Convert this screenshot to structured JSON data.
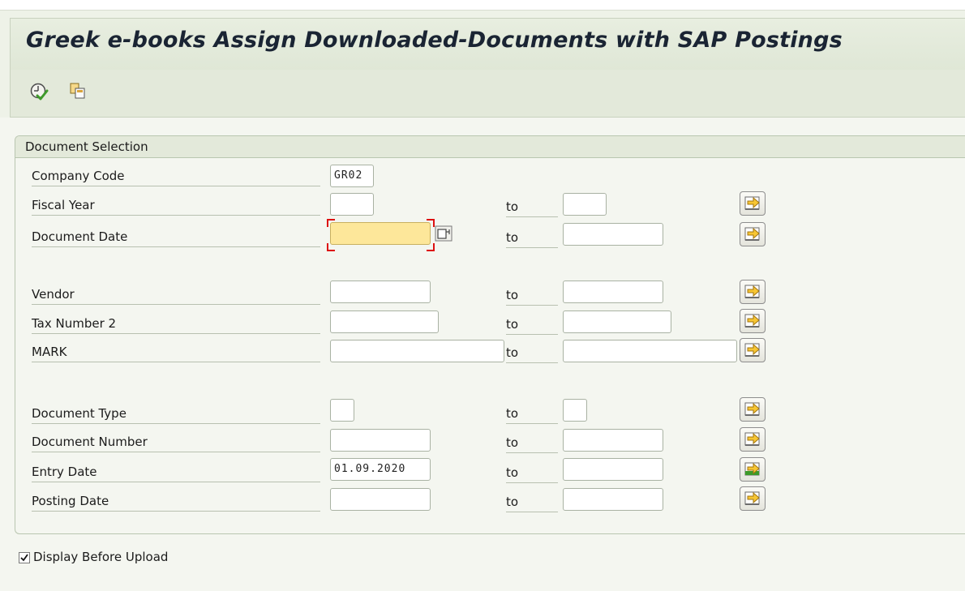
{
  "header": {
    "title": "Greek e-books Assign Downloaded-Documents with SAP Postings"
  },
  "toolbar": {
    "icons": [
      "execute-icon",
      "copy-icon"
    ]
  },
  "selection": {
    "group_title": "Document Selection",
    "to_label": "to",
    "rows": [
      {
        "label": "Company Code",
        "from": "GR02"
      },
      {
        "label": "Fiscal Year",
        "from": "",
        "to": ""
      },
      {
        "label": "Document Date",
        "from": "",
        "to": ""
      },
      {
        "label": "Vendor",
        "from": "",
        "to": ""
      },
      {
        "label": "Tax Number 2",
        "from": "",
        "to": ""
      },
      {
        "label": "MARK",
        "from": "",
        "to": ""
      },
      {
        "label": "Document Type",
        "from": "",
        "to": ""
      },
      {
        "label": "Document Number",
        "from": "",
        "to": ""
      },
      {
        "label": "Entry Date",
        "from": "01.09.2020",
        "to": ""
      },
      {
        "label": "Posting Date",
        "from": "",
        "to": ""
      }
    ]
  },
  "options": {
    "display_before_upload": {
      "label": "Display Before Upload",
      "checked": true
    }
  },
  "colors": {
    "title_bg": "#dfe7d6",
    "active_field": "#fde79a",
    "focus_marker": "#dd1111"
  }
}
